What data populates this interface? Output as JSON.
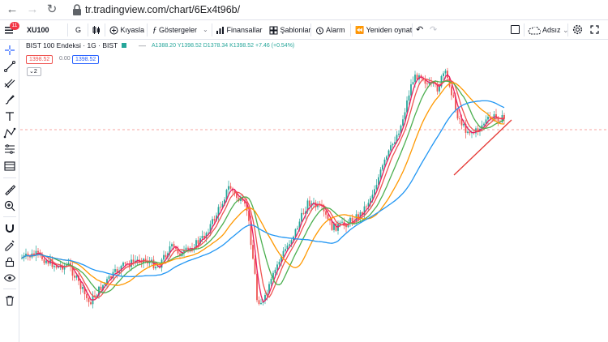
{
  "browser": {
    "url": "tr.tradingview.com/chart/6Ex4t96b/"
  },
  "toolbar": {
    "notification_count": "11",
    "symbol": "XU100",
    "interval": "G",
    "compare_label": "Kıyasla",
    "indicators_label": "Göstergeler",
    "financials_label": "Finansallar",
    "templates_label": "Şablonlar",
    "alarm_label": "Alarm",
    "replay_label": "Yeniden oynat",
    "layout_name": "Adsız"
  },
  "legend": {
    "title": "BIST 100 Endeksi · 1G · BIST",
    "open": "A1388.20",
    "high": "Y1398.52",
    "low": "D1378.34",
    "close": "K1398.52",
    "change": "+7.46 (+0.54%)",
    "badge_bid": "1398.52",
    "badge_spread": "0.00",
    "badge_ask": "1398.52",
    "collapse_count": "2"
  },
  "colors": {
    "candle_up": "#26a69a",
    "candle_down": "#ef5350",
    "ma1": "#e91e63",
    "ma2": "#ef5350",
    "ma3": "#4caf50",
    "ma4": "#ff9800",
    "ma5": "#2196f3",
    "trendline": "#e53935",
    "price_line": "#ef5350"
  },
  "icons": [
    "menu-icon",
    "crosshair-icon",
    "trendline-icon",
    "pitchfork-icon",
    "brush-icon",
    "text-icon",
    "pattern-icon",
    "forecast-icon",
    "measure-icon",
    "ruler-icon",
    "zoom-in-icon",
    "magnet-icon",
    "lock-drawing-icon",
    "lock-icon",
    "eye-icon",
    "trash-icon"
  ]
}
